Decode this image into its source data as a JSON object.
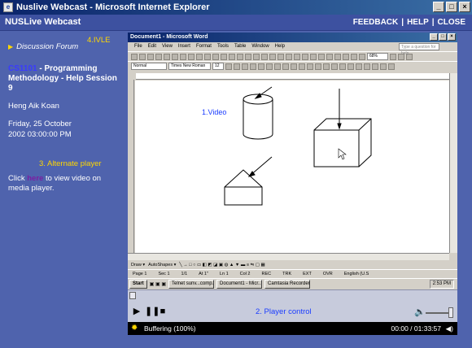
{
  "window": {
    "title": "Nuslive Webcast - Microsoft Internet Explorer"
  },
  "header": {
    "title": "NUSLive Webcast",
    "nav": [
      "FEEDBACK",
      "HELP",
      "CLOSE"
    ],
    "nav_sep": "|"
  },
  "sidebar": {
    "forum_link": "Discussion Forum",
    "ivle_label": "4.IVLE",
    "course_code": "CS1101",
    "course_title": " - Programming Methodology - Help Session 9",
    "lecturer": "Heng Aik Koan",
    "date_line1": "Friday, 25 October",
    "date_line2": "2002 03:00:00 PM",
    "alt_player_label": "3. Alternate player",
    "click_prefix": "Click ",
    "click_link": "here",
    "click_suffix": " to view video on media player."
  },
  "video": {
    "word_title": "Document1 - Microsoft Word",
    "word_menu": [
      "File",
      "Edit",
      "View",
      "Insert",
      "Format",
      "Tools",
      "Table",
      "Window",
      "Help"
    ],
    "help_box_placeholder": "Type a question for help",
    "style_combo": "Normal",
    "font_combo": "Times New Roman",
    "size_combo": "12",
    "zoom_combo": "68%",
    "video_label": "1.Video",
    "draw_toolbar": [
      "Draw ▾",
      "AutoShapes ▾"
    ],
    "word_status": [
      "Page 1",
      "Sec 1",
      "1/1",
      "At 1\"",
      "Ln 1",
      "Col 2",
      "REC",
      "TRK",
      "EXT",
      "OVR",
      "English (U.S"
    ],
    "taskbar_start": "Start",
    "taskbar_tasks": [
      "Telnet sunv...comp...",
      "Document1 - Micr...",
      "Camtasia Recorder"
    ],
    "taskbar_clock": "2:53 PM"
  },
  "player": {
    "label": "2. Player control",
    "buffer_status": "Buffering (100%)",
    "time": "00:00 / 01:33:57",
    "volume": 0.85
  },
  "colors": {
    "page_bg": "#4f63ad",
    "accent_yellow": "#ffd700",
    "course_code": "#3a3aff",
    "link_purple": "#7b1fa2",
    "player_label": "#1a3cff"
  }
}
